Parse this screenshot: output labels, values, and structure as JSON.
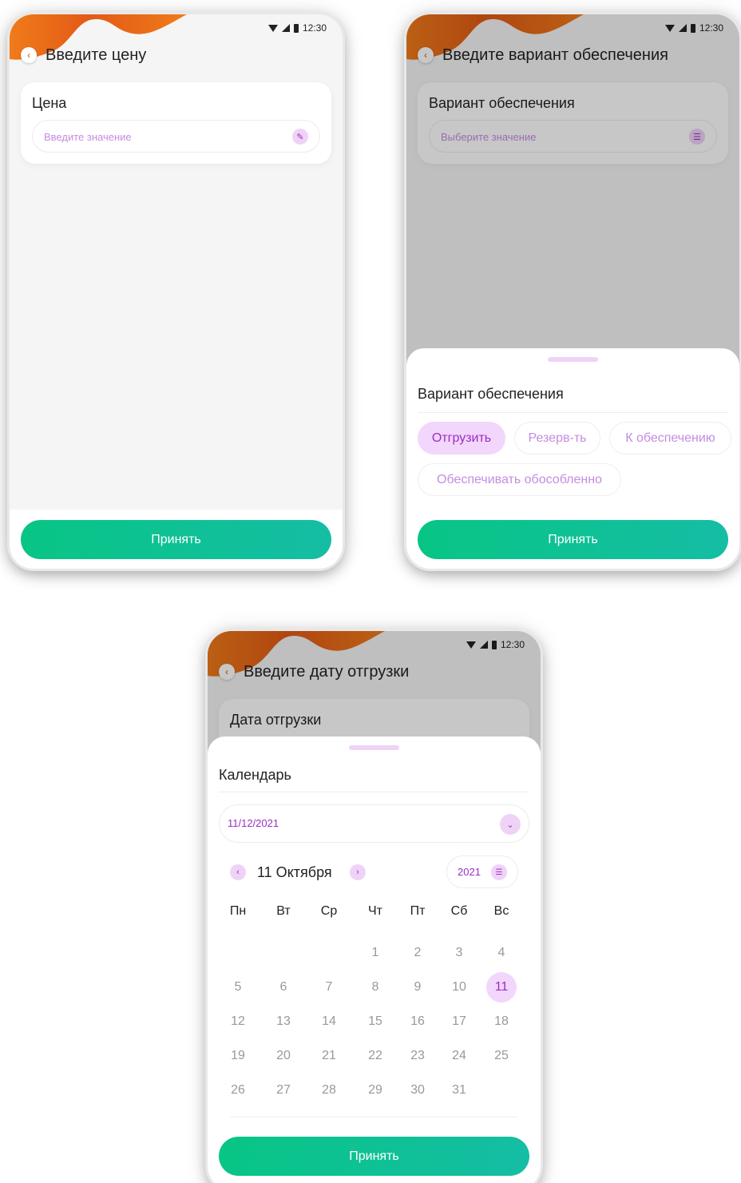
{
  "colors": {
    "accent_orange": "#f07b1a",
    "accent_purple": "#9a2fc1",
    "chip_active_bg": "#f2d6fb",
    "button_green": "#08c585",
    "background": "#f5f5f5"
  },
  "status_bar": {
    "time": "12:30"
  },
  "screen1": {
    "title": "Введите цену",
    "card_label": "Цена",
    "input_placeholder": "Введите значение",
    "input_icon": "pencil-icon",
    "accept_label": "Принять"
  },
  "screen2": {
    "title": "Введите вариант обеспечения",
    "card_label": "Вариант обеспечения",
    "input_placeholder": "Выберите значение",
    "input_icon": "list-icon",
    "sheet_title": "Вариант обеспечения",
    "chips": [
      {
        "label": "Отгрузить",
        "selected": true
      },
      {
        "label": "Резерв-ть",
        "selected": false
      },
      {
        "label": "К обеспечению",
        "selected": false
      },
      {
        "label": "Обеспечивать обособленно",
        "selected": false
      }
    ],
    "accept_label": "Принять"
  },
  "screen3": {
    "title": "Введите дату отгрузки",
    "card_label": "Дата отгрузки",
    "sheet_title": "Календарь",
    "date_value": "11/12/2021",
    "month_label": "11 Октября",
    "year_value": "2021",
    "weekdays": [
      "Пн",
      "Вт",
      "Ср",
      "Чт",
      "Пт",
      "Сб",
      "Вс"
    ],
    "weeks": [
      [
        "",
        "",
        "",
        "1",
        "2",
        "3",
        "4"
      ],
      [
        "5",
        "6",
        "7",
        "8",
        "9",
        "10",
        "11"
      ],
      [
        "12",
        "13",
        "14",
        "15",
        "16",
        "17",
        "18"
      ],
      [
        "19",
        "20",
        "21",
        "22",
        "23",
        "24",
        "25"
      ],
      [
        "26",
        "27",
        "28",
        "29",
        "30",
        "31",
        ""
      ]
    ],
    "selected_day": "11",
    "accept_label": "Принять"
  }
}
